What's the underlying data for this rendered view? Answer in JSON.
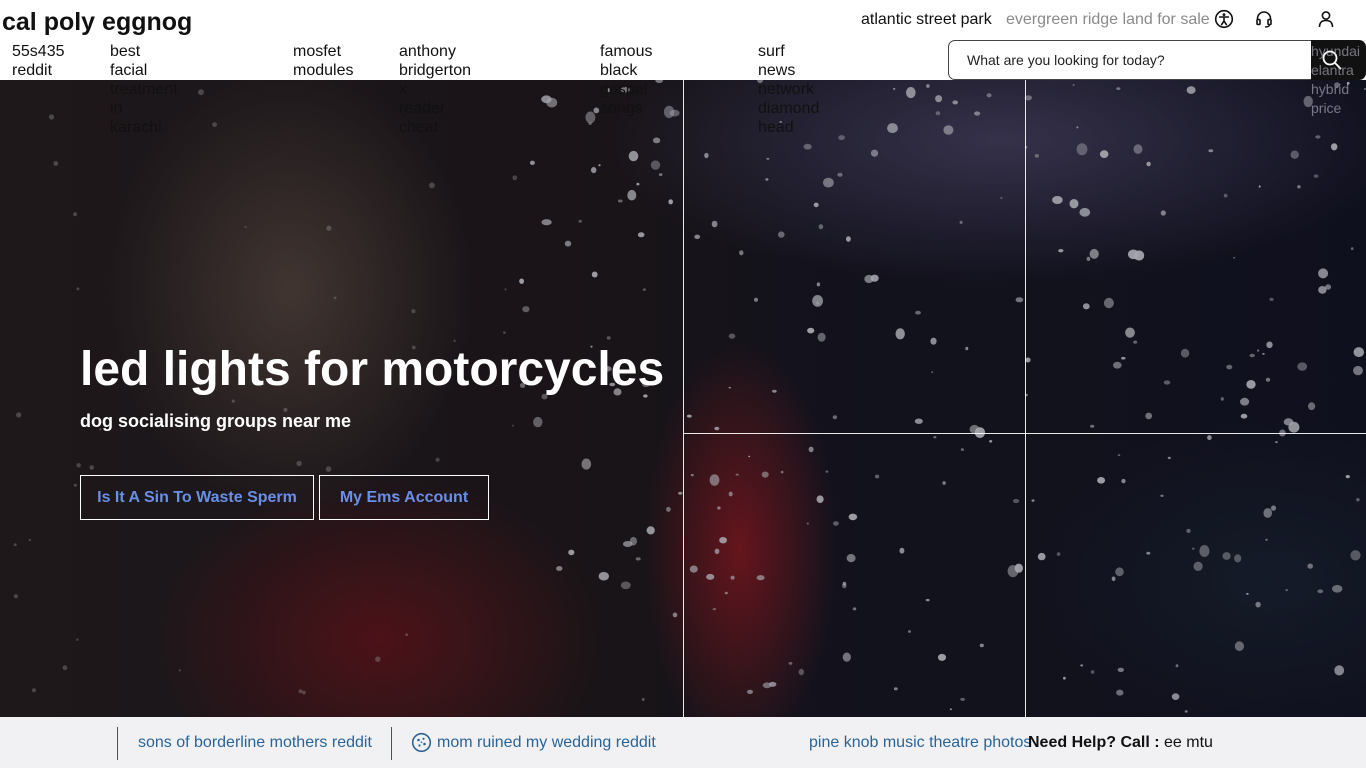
{
  "header": {
    "site_title": "cal poly eggnog",
    "util_links": [
      "atlantic street park",
      "evergreen ridge land for sale"
    ],
    "icons": [
      "accessibility-icon",
      "headset-icon",
      "user-icon"
    ]
  },
  "nav": {
    "items": [
      "55s435\nreddit",
      "best facial treatment\nin karachi",
      "mosfet\nmodules",
      "anthony bridgerton x\nreader cheat",
      "famous black\ngospel songs",
      "surf news network\ndiamond head"
    ],
    "overflow_text": "hyundai elantra hybrid price"
  },
  "search": {
    "placeholder": "What are you looking for today?",
    "value": ""
  },
  "hero": {
    "heading": "led lights for motorcycles",
    "subheading": "dog socialising groups near me",
    "buttons": [
      "Is It A Sin To Waste Sperm",
      "My Ems Account"
    ]
  },
  "footer": {
    "links": [
      "sons of borderline mothers reddit",
      "mom ruined my wedding reddit",
      "pine knob music theatre photos"
    ],
    "help_label": "Need Help? Call :",
    "help_value": " ee mtu"
  },
  "colors": {
    "link_blue": "#2a6496",
    "button_text": "#6a8fe8",
    "footer_bg": "#f1f1f3",
    "search_button_bg": "#111111"
  }
}
